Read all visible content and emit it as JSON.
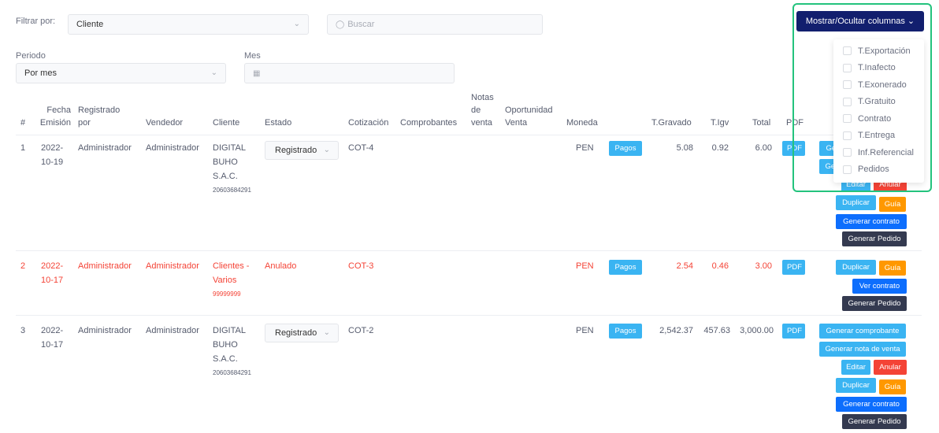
{
  "filters": {
    "filter_label": "Filtrar por:",
    "filter_value": "Cliente",
    "search_placeholder": "Buscar",
    "periodo_label": "Periodo",
    "periodo_value": "Por mes",
    "mes_label": "Mes"
  },
  "columns_toggle": {
    "button_label": "Mostrar/Ocultar columnas",
    "options": [
      "T.Exportación",
      "T.Inafecto",
      "T.Exonerado",
      "T.Gratuito",
      "Contrato",
      "T.Entrega",
      "Inf.Referencial",
      "Pedidos"
    ]
  },
  "table": {
    "headers": {
      "num": "#",
      "fecha": "Fecha Emisión",
      "registrado": "Registrado por",
      "vendedor": "Vendedor",
      "cliente": "Cliente",
      "estado": "Estado",
      "cotizacion": "Cotización",
      "comprobantes": "Comprobantes",
      "notas": "Notas de venta",
      "oportunidad": "Oportunidad Venta",
      "moneda": "Moneda",
      "gravado": "T.Gravado",
      "igv": "T.Igv",
      "total": "Total",
      "pdf": "PDF"
    },
    "rows": [
      {
        "num": "1",
        "fecha": "2022-10-19",
        "registrado": "Administrador",
        "vendedor": "Administrador",
        "cliente": "DIGITAL BUHO S.A.C.",
        "ruc": "20603684291",
        "estado": "Registrado",
        "cotizacion": "COT-4",
        "moneda": "PEN",
        "pagos": "Pagos",
        "gravado": "5.08",
        "igv": "0.92",
        "total": "6.00",
        "pdf": "PDF",
        "actions": [
          "Generar comprobante",
          "Generar nota de venta",
          "Editar",
          "Anular",
          "Duplicar",
          "Guía",
          "Generar contrato",
          "Generar Pedido"
        ]
      },
      {
        "num": "2",
        "fecha": "2022-10-17",
        "registrado": "Administrador",
        "vendedor": "Administrador",
        "cliente": "Clientes - Varios",
        "ruc": "99999999",
        "estado": "Anulado",
        "cotizacion": "COT-3",
        "moneda": "PEN",
        "pagos": "Pagos",
        "gravado": "2.54",
        "igv": "0.46",
        "total": "3.00",
        "pdf": "PDF",
        "actions": [
          "Duplicar",
          "Guía",
          "Ver contrato",
          "Generar Pedido"
        ]
      },
      {
        "num": "3",
        "fecha": "2022-10-17",
        "registrado": "Administrador",
        "vendedor": "Administrador",
        "cliente": "DIGITAL BUHO S.A.C.",
        "ruc": "20603684291",
        "estado": "Registrado",
        "cotizacion": "COT-2",
        "moneda": "PEN",
        "pagos": "Pagos",
        "gravado": "2,542.37",
        "igv": "457.63",
        "total": "3,000.00",
        "pdf": "PDF",
        "actions": [
          "Generar comprobante",
          "Generar nota de venta",
          "Editar",
          "Anular",
          "Duplicar",
          "Guía",
          "Generar contrato",
          "Generar Pedido"
        ]
      }
    ]
  },
  "colors": {
    "toggle_bg": "#121f6e",
    "highlight": "#23c37d",
    "info": "#3ab4f2",
    "danger": "#f44336",
    "warning": "#ff9800",
    "primary": "#0d6efd",
    "dark": "#343a50"
  }
}
